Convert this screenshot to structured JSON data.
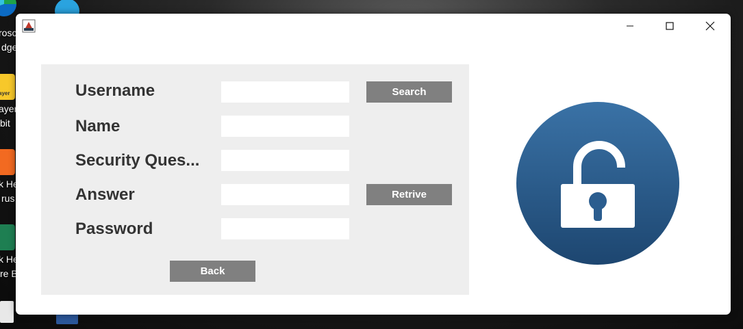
{
  "desktop": {
    "icons": [
      {
        "name": "edge-icon",
        "lines": [
          "rosc",
          "dge"
        ]
      },
      {
        "name": "telegram-icon",
        "lines": []
      },
      {
        "name": "player-icon",
        "lines": [
          "ayer",
          "bit"
        ]
      },
      {
        "name": "q-app-icon",
        "lines": [
          "k He",
          "rus"
        ]
      },
      {
        "name": "q-app2-icon",
        "lines": [
          "k He",
          "re B"
        ]
      }
    ],
    "icon_small_text": "ayer"
  },
  "window": {
    "controls": [
      "minimize",
      "maximize",
      "close"
    ]
  },
  "form": {
    "fields": [
      {
        "label": "Username",
        "value": ""
      },
      {
        "label": "Name",
        "value": ""
      },
      {
        "label": "Security Ques...",
        "value": ""
      },
      {
        "label": "Answer",
        "value": ""
      },
      {
        "label": "Password",
        "value": ""
      }
    ],
    "search_label": "Search",
    "retrieve_label": "Retrive",
    "back_label": "Back"
  },
  "colors": {
    "panel": "#eeeeee",
    "button": "#808080",
    "lock_circle_top": "#3a72a6",
    "lock_circle_bottom": "#1d4670"
  },
  "icons": {
    "lock": "unlocked-padlock-icon"
  }
}
